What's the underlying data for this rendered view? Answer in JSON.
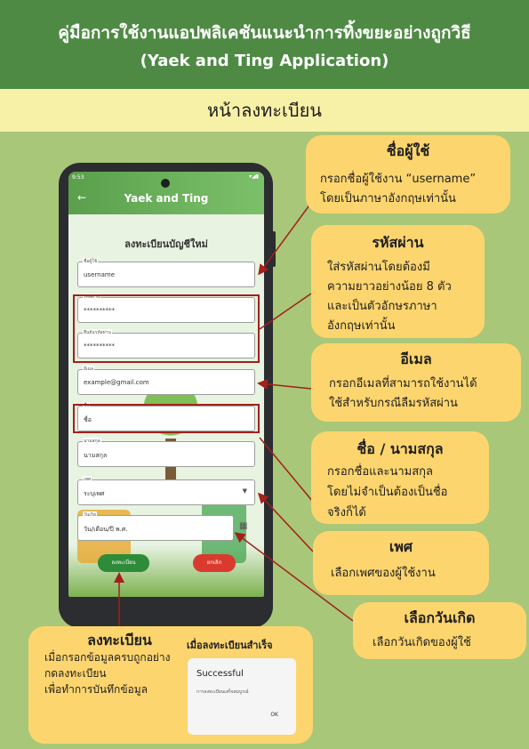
{
  "header": {
    "title_th": "คู่มือการใช้งานแอปพลิเคชันแนะนำการทิ้งขยะอย่างถูกวิธี",
    "title_en": "(Yaek and Ting Application)"
  },
  "section_title": "หน้าลงทะเบียน",
  "phone": {
    "status_time": "9:53",
    "app_title": "Yaek and Ting",
    "form_title": "ลงทะเบียนบัญชีใหม่",
    "fields": {
      "username": {
        "label": "ชื่อผู้ใช้",
        "value": "username"
      },
      "password": {
        "label": "รหัสผ่าน",
        "value": "**********"
      },
      "confirm_password": {
        "label": "ยืนยันรหัสผ่าน",
        "value": "**********"
      },
      "email": {
        "label": "อีเมล",
        "value": "example@gmail.com"
      },
      "first_name": {
        "label": "ชื่อ",
        "value": "ชื่อ"
      },
      "last_name": {
        "label": "นามสกุล",
        "value": "นามสกุล"
      },
      "gender": {
        "label": "เพศ",
        "value": "ระบุเพศ"
      },
      "birthdate": {
        "label": "วันเกิด",
        "value": "วัน/เดือน/ปี พ.ศ."
      }
    },
    "register_button": "ลงทะเบียน",
    "cancel_button": "ยกเลิก"
  },
  "callouts": {
    "username": {
      "title": "ชื่อผู้ใช้",
      "lines": [
        "กรอกชื่อผู้ใช้งาน “username”",
        "โดยเป็นภาษาอังกฤษเท่านั้น"
      ]
    },
    "password": {
      "title": "รหัสผ่าน",
      "lines": [
        "ใส่รหัสผ่านโดยต้องมี",
        "ความยาวอย่างน้อย 8 ตัว",
        "และเป็นตัวอักษรภาษา",
        "อังกฤษเท่านั้น"
      ]
    },
    "email": {
      "title": "อีเมล",
      "lines": [
        "กรอกอีเมลที่สามารถใช้งานได้",
        "ใช้สำหรับกรณีลืมรหัสผ่าน"
      ]
    },
    "name": {
      "title": "ชื่อ / นามสกุล",
      "lines": [
        "กรอกชื่อและนามสกุล",
        "โดยไม่จำเป็นต้องเป็นชื่อ",
        "จริงก็ได้"
      ]
    },
    "gender": {
      "title": "เพศ",
      "lines": [
        "เลือกเพศของผู้ใช้งาน"
      ]
    },
    "birthdate": {
      "title": "เลือกวันเกิด",
      "lines": [
        "เลือกวันเกิดของผู้ใช้"
      ]
    },
    "register": {
      "title": "ลงทะเบียน",
      "lines": [
        "เมื่อกรอกข้อมูลครบถูกอย่าง",
        "กดลงทะเบียน",
        "เพื่อทำการบันทึกข้อมูล"
      ],
      "success_heading": "เมื่อลงทะเบียนสำเร็จ"
    }
  },
  "dialog": {
    "title": "Successful",
    "message": "การลงทะเบียนเสร็จสมบูรณ์",
    "ok": "OK"
  },
  "colors": {
    "header_bg": "#4e8a44",
    "subheader_bg": "#f7f1a7",
    "page_bg": "#a9c778",
    "callout_bg": "#fdd56e",
    "highlight": "#a3201b",
    "register_btn": "#2e8b3a",
    "cancel_btn": "#d93a2e"
  }
}
